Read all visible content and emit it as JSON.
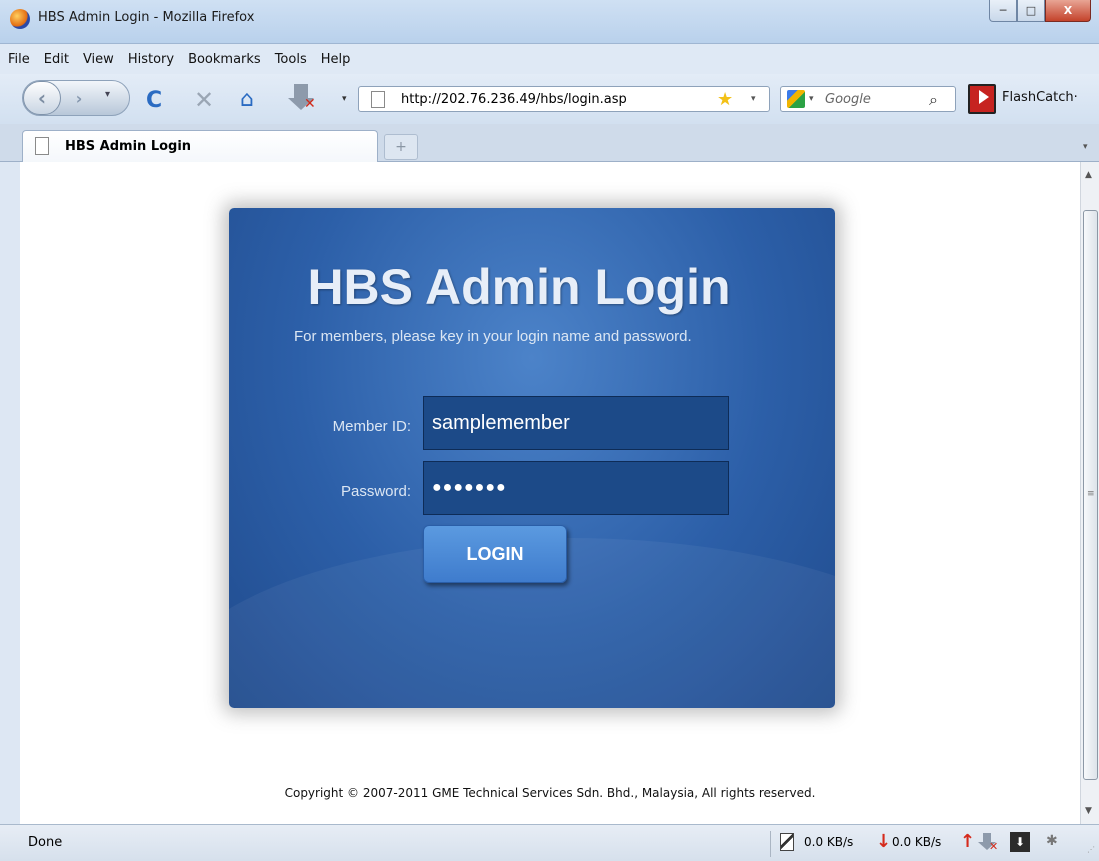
{
  "window": {
    "title": "HBS Admin Login - Mozilla Firefox",
    "min": "─",
    "max": "□",
    "close": "X"
  },
  "menu": [
    "File",
    "Edit",
    "View",
    "History",
    "Bookmarks",
    "Tools",
    "Help"
  ],
  "nav": {
    "back": "‹",
    "forward": "›",
    "dropdown": "▾",
    "url": "http://202.76.236.49/hbs/login.asp",
    "search_placeholder": "Google",
    "addon_label": "FlashCatch·"
  },
  "tab": {
    "label": "HBS Admin Login",
    "new_tab": "+"
  },
  "login": {
    "title": "HBS Admin Login",
    "subtitle": "For members, please key in your login name and password.",
    "member_label": "Member ID:",
    "member_value": "samplemember",
    "password_label": "Password:",
    "password_value": "●●●●●●●",
    "button": "LOGIN"
  },
  "copyright": "Copyright © 2007-2011 GME Technical Services Sdn. Bhd., Malaysia, All rights reserved.",
  "status": {
    "text": "Done",
    "down_speed": "0.0 KB/s",
    "up_speed": "0.0 KB/s"
  },
  "colors": {
    "panel": "#2c5fa8",
    "button": "#4a8ad8",
    "input_bg": "#1c4a88"
  },
  "icons": [
    "firefox-icon",
    "reload-icon",
    "stop-icon",
    "home-icon",
    "download-icon",
    "star-icon",
    "search-icon",
    "flashcatch-icon"
  ]
}
